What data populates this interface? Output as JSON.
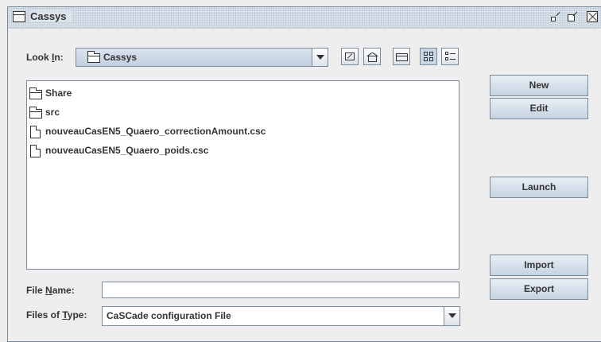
{
  "window": {
    "title": "Cassys"
  },
  "look_in": {
    "label_pre": "Look ",
    "label_mnemonic": "I",
    "label_post": "n:",
    "value": "Cassys"
  },
  "toolbar": {
    "icons": [
      "up-folder-icon",
      "home-icon",
      "new-folder-icon",
      "list-view-icon",
      "details-view-icon"
    ]
  },
  "files": [
    {
      "name": "Share",
      "kind": "folder"
    },
    {
      "name": "src",
      "kind": "folder"
    },
    {
      "name": "nouveauCasEN5_Quaero_correctionAmount.csc",
      "kind": "file"
    },
    {
      "name": "nouveauCasEN5_Quaero_poids.csc",
      "kind": "file"
    }
  ],
  "file_name": {
    "label_pre": "File ",
    "label_mnemonic": "N",
    "label_post": "ame:",
    "value": ""
  },
  "file_type": {
    "label_pre": "Files of ",
    "label_mnemonic": "T",
    "label_post": "ype:",
    "value": "CaSCade configuration File"
  },
  "buttons": {
    "new": "New",
    "edit": "Edit",
    "launch": "Launch",
    "import": "Import",
    "export": "Export"
  },
  "colors": {
    "panel": "#eeeeee",
    "border": "#7a8a99",
    "button_gradient_top": "#e8eef4",
    "button_gradient_bottom": "#c5d3e1",
    "text": "#333333"
  }
}
